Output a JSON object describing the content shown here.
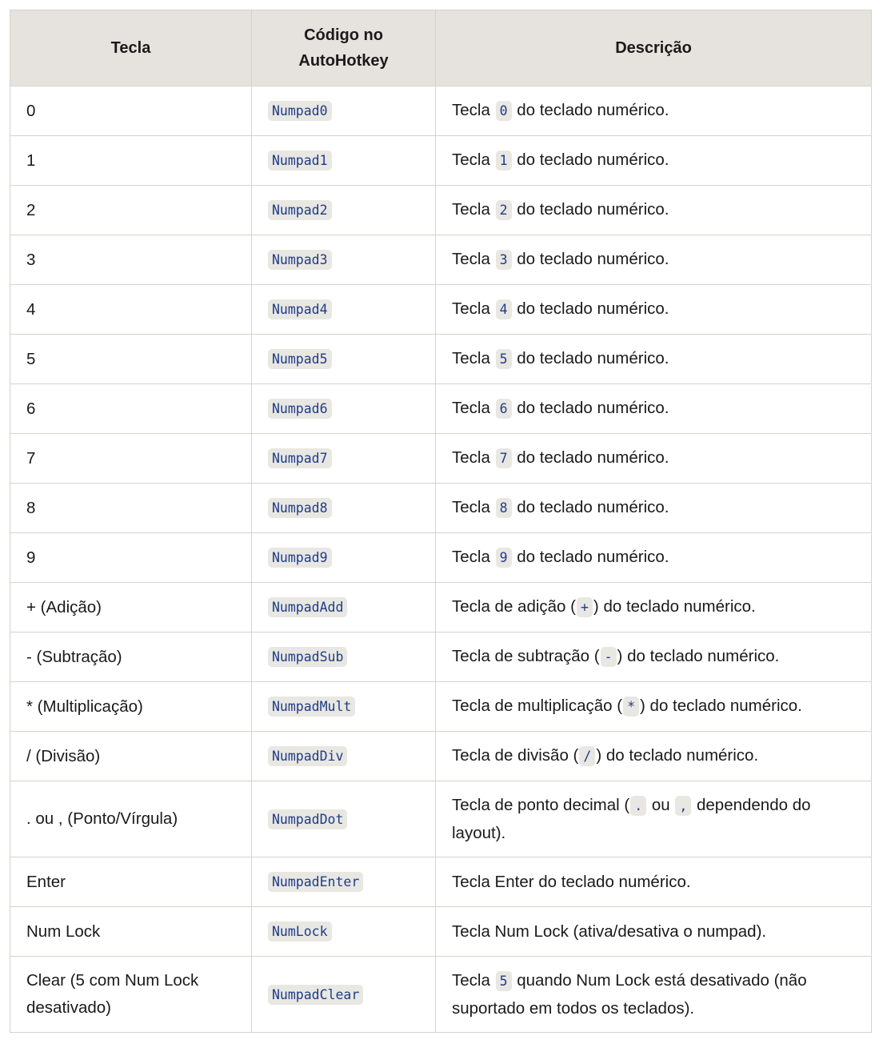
{
  "table": {
    "headers": [
      "Tecla",
      "Código no AutoHotkey",
      "Descrição"
    ],
    "rows": [
      {
        "tecla": "0",
        "codigo": "Numpad0",
        "desc": [
          {
            "t": "Tecla "
          },
          {
            "c": "0"
          },
          {
            "t": " do teclado numérico."
          }
        ]
      },
      {
        "tecla": "1",
        "codigo": "Numpad1",
        "desc": [
          {
            "t": "Tecla "
          },
          {
            "c": "1"
          },
          {
            "t": " do teclado numérico."
          }
        ]
      },
      {
        "tecla": "2",
        "codigo": "Numpad2",
        "desc": [
          {
            "t": "Tecla "
          },
          {
            "c": "2"
          },
          {
            "t": " do teclado numérico."
          }
        ]
      },
      {
        "tecla": "3",
        "codigo": "Numpad3",
        "desc": [
          {
            "t": "Tecla "
          },
          {
            "c": "3"
          },
          {
            "t": " do teclado numérico."
          }
        ]
      },
      {
        "tecla": "4",
        "codigo": "Numpad4",
        "desc": [
          {
            "t": "Tecla "
          },
          {
            "c": "4"
          },
          {
            "t": " do teclado numérico."
          }
        ]
      },
      {
        "tecla": "5",
        "codigo": "Numpad5",
        "desc": [
          {
            "t": "Tecla "
          },
          {
            "c": "5"
          },
          {
            "t": " do teclado numérico."
          }
        ]
      },
      {
        "tecla": "6",
        "codigo": "Numpad6",
        "desc": [
          {
            "t": "Tecla "
          },
          {
            "c": "6"
          },
          {
            "t": " do teclado numérico."
          }
        ]
      },
      {
        "tecla": "7",
        "codigo": "Numpad7",
        "desc": [
          {
            "t": "Tecla "
          },
          {
            "c": "7"
          },
          {
            "t": " do teclado numérico."
          }
        ]
      },
      {
        "tecla": "8",
        "codigo": "Numpad8",
        "desc": [
          {
            "t": "Tecla "
          },
          {
            "c": "8"
          },
          {
            "t": " do teclado numérico."
          }
        ]
      },
      {
        "tecla": "9",
        "codigo": "Numpad9",
        "desc": [
          {
            "t": "Tecla "
          },
          {
            "c": "9"
          },
          {
            "t": " do teclado numérico."
          }
        ]
      },
      {
        "tecla": "+ (Adição)",
        "codigo": "NumpadAdd",
        "desc": [
          {
            "t": "Tecla de adição ("
          },
          {
            "c": "+"
          },
          {
            "t": ") do teclado numérico."
          }
        ]
      },
      {
        "tecla": "- (Subtração)",
        "codigo": "NumpadSub",
        "desc": [
          {
            "t": "Tecla de subtração ("
          },
          {
            "c": "-"
          },
          {
            "t": ") do teclado numérico."
          }
        ]
      },
      {
        "tecla": "* (Multiplicação)",
        "codigo": "NumpadMult",
        "desc": [
          {
            "t": "Tecla de multiplicação ("
          },
          {
            "c": "*"
          },
          {
            "t": ") do teclado numérico."
          }
        ]
      },
      {
        "tecla": "/ (Divisão)",
        "codigo": "NumpadDiv",
        "desc": [
          {
            "t": "Tecla de divisão ("
          },
          {
            "c": "/"
          },
          {
            "t": ") do teclado numérico."
          }
        ]
      },
      {
        "tecla": ". ou , (Ponto/Vírgula)",
        "codigo": "NumpadDot",
        "tall": true,
        "desc": [
          {
            "t": "Tecla de ponto decimal ("
          },
          {
            "c": "."
          },
          {
            "t": " ou "
          },
          {
            "c": ","
          },
          {
            "t": " dependendo do layout)."
          }
        ]
      },
      {
        "tecla": "Enter",
        "codigo": "NumpadEnter",
        "desc": [
          {
            "t": "Tecla Enter do teclado numérico."
          }
        ]
      },
      {
        "tecla": "Num Lock",
        "codigo": "NumLock",
        "desc": [
          {
            "t": "Tecla Num Lock (ativa/desativa o numpad)."
          }
        ]
      },
      {
        "tecla": "Clear (5 com Num Lock desativado)",
        "codigo": "NumpadClear",
        "tall": true,
        "desc": [
          {
            "t": "Tecla "
          },
          {
            "c": "5"
          },
          {
            "t": " quando Num Lock está desativado (não suportado em todos os teclados)."
          }
        ]
      }
    ]
  }
}
